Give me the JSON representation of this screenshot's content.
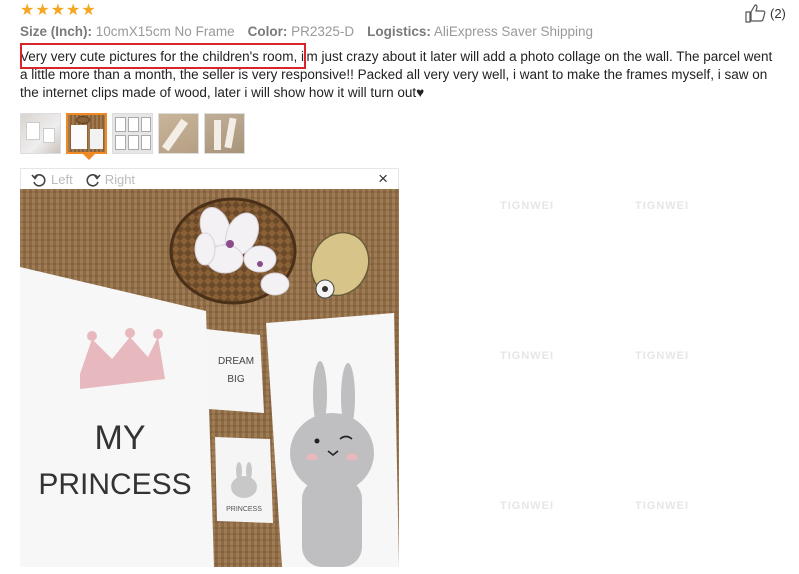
{
  "rating": {
    "stars": 5
  },
  "helpful": {
    "count": "(2)",
    "icon": "thumbs-up-icon"
  },
  "meta": {
    "size_label": "Size (Inch):",
    "size_value": "10cmX15cm No Frame",
    "color_label": "Color:",
    "color_value": "PR2325-D",
    "logistics_label": "Logistics:",
    "logistics_value": "AliExpress Saver Shipping"
  },
  "review": {
    "text": "Very very cute pictures for the children's room, i'm just crazy about it later will add a photo collage on the wall. The parcel went a little more than a month, the seller is very responsive!! Packed all very very well, i want to make the frames myself, i saw on the internet clips made of wood, later i will show how it will turn out♥"
  },
  "viewer": {
    "rotate_left": "Left",
    "rotate_right": "Right",
    "close": "×"
  },
  "photo": {
    "poster_title_line1": "MY",
    "poster_title_line2": "PRINCESS",
    "card1_line1": "DREAM",
    "card1_line2": "BIG",
    "card2_text": "PRINCESS"
  },
  "watermarks": [
    "TIGNWEI",
    "TIGNWEI",
    "TIGNWEI",
    "TIGNWEI",
    "TIGNWEI",
    "TIGNWEI"
  ],
  "colors": {
    "star": "#f5a623",
    "highlight": "#d6262a",
    "active_thumb": "#f08a24"
  }
}
